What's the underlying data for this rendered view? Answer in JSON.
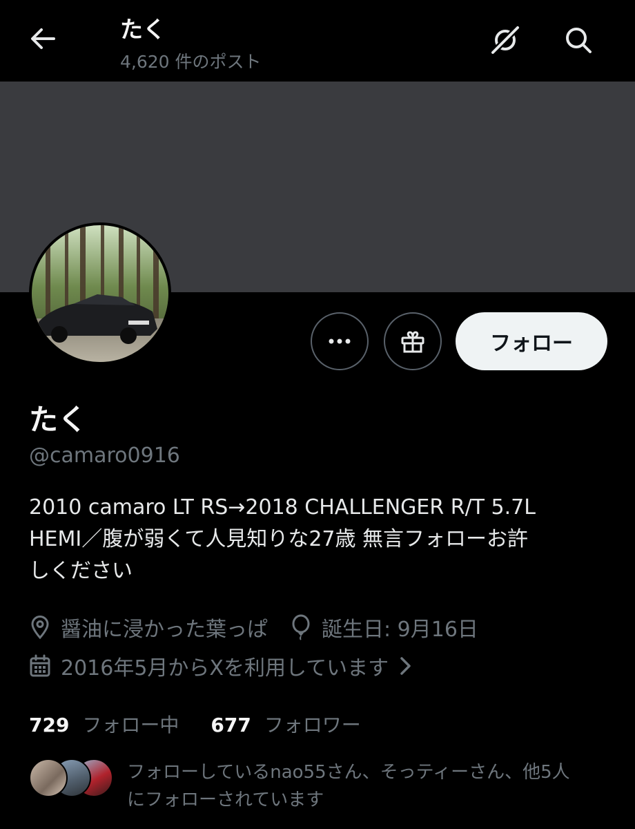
{
  "header": {
    "title": "たく",
    "post_count": "4,620 件のポスト"
  },
  "actions": {
    "follow_label": "フォロー"
  },
  "profile": {
    "display_name": "たく",
    "handle": "@camaro0916",
    "bio_line1": "2010 camaro LT RS→2018 CHALLENGER R/T 5.7L",
    "bio_line2": "HEMI／腹が弱くて人見知りな27歳 無言フォローお許",
    "bio_line3": "しください",
    "location": "醤油に浸かった葉っぱ",
    "birthday": "誕生日: 9月16日",
    "joined": "2016年5月からXを利用しています"
  },
  "stats": {
    "following_count": "729",
    "following_label": "フォロー中",
    "followers_count": "677",
    "followers_label": "フォロワー"
  },
  "followed_by": {
    "line1": "フォローしているnao55さん、そっティーさん、他5人",
    "line2": "にフォローされています"
  },
  "icons": [
    "arrow-left-icon",
    "grok-icon",
    "search-icon",
    "more-icon",
    "gift-icon",
    "location-icon",
    "balloon-icon",
    "calendar-icon",
    "chevron-right-icon"
  ],
  "colors": {
    "background": "#000000",
    "banner": "#3a3b3f",
    "secondary_text": "#6e767d",
    "primary_text": "#e7e9ea",
    "follow_button_bg": "#eff3f4"
  }
}
